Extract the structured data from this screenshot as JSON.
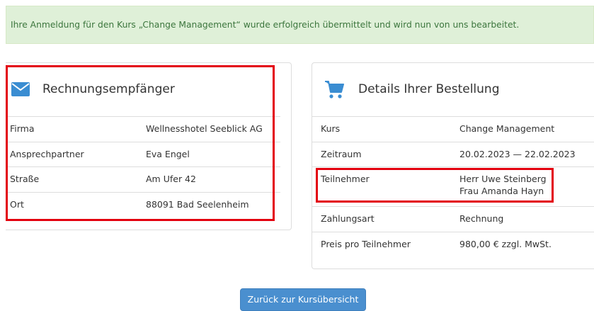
{
  "alert": {
    "message": "Ihre Anmeldung für den Kurs „Change Management“ wurde erfolgreich übermittelt und wird nun von uns bearbeitet."
  },
  "invoice": {
    "title": "Rechnungsempfänger",
    "icon": "envelope-icon",
    "rows": [
      {
        "label": "Firma",
        "value": "Wellnesshotel Seeblick AG"
      },
      {
        "label": "Ansprechpartner",
        "value": "Eva Engel"
      },
      {
        "label": "Straße",
        "value": "Am Ufer 42"
      },
      {
        "label": "Ort",
        "value": "88091 Bad Seelenheim"
      }
    ]
  },
  "order": {
    "title": "Details Ihrer Bestellung",
    "icon": "shopping-cart-icon",
    "rows": [
      {
        "label": "Kurs",
        "value": "Change Management"
      },
      {
        "label": "Zeitraum",
        "value": "20.02.2023 — 22.02.2023"
      },
      {
        "label": "Teilnehmer",
        "values": [
          "Herr Uwe Steinberg",
          "Frau Amanda Hayn"
        ]
      },
      {
        "label": "Zahlungsart",
        "value": "Rechnung"
      },
      {
        "label": "Preis pro Teilnehmer",
        "value": "980,00 € zzgl. MwSt."
      }
    ]
  },
  "actions": {
    "back_label": "Zurück zur Kursübersicht"
  },
  "colors": {
    "alert_bg": "#dff0d8",
    "alert_text": "#3c763d",
    "icon_blue": "#3a8dd2",
    "button_bg": "#4a8fcf",
    "highlight_red": "#e3000f"
  }
}
